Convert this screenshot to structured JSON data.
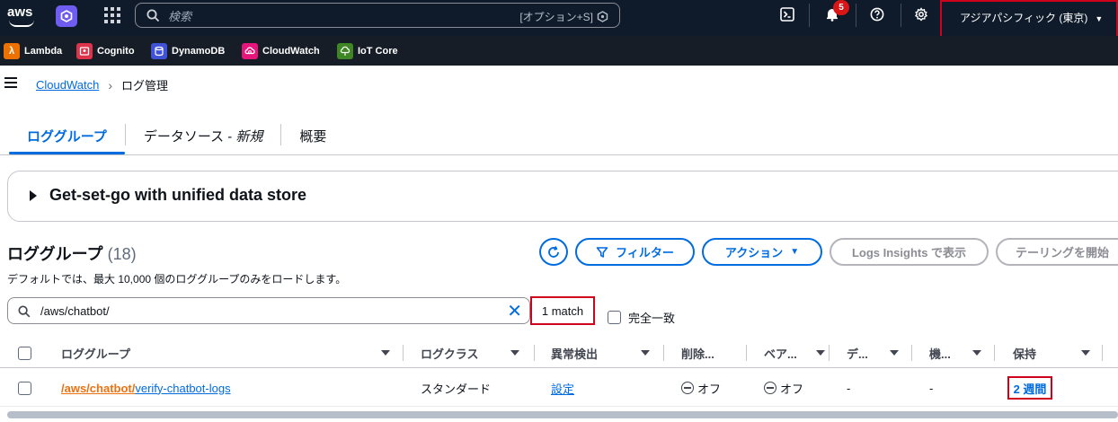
{
  "topnav": {
    "logo_text": "aws",
    "search_placeholder": "検索",
    "search_shortcut": "[オプション+S]",
    "notifications_count": "5",
    "region": "アジアパシフィック (東京)"
  },
  "favorites": [
    {
      "label": "Lambda",
      "color": "#ed7100",
      "icon": "lambda-icon"
    },
    {
      "label": "Cognito",
      "color": "#dd344c",
      "icon": "cognito-icon"
    },
    {
      "label": "DynamoDB",
      "color": "#4053d6",
      "icon": "dynamodb-icon"
    },
    {
      "label": "CloudWatch",
      "color": "#e7157b",
      "icon": "cloudwatch-icon"
    },
    {
      "label": "IoT Core",
      "color": "#3f8624",
      "icon": "iot-core-icon"
    }
  ],
  "breadcrumb": {
    "root": "CloudWatch",
    "current": "ログ管理"
  },
  "tabs": {
    "log_groups": "ロググループ",
    "data_sources_prefix": "データソース - ",
    "data_sources_new": "新規",
    "overview": "概要"
  },
  "expander": {
    "title": "Get-set-go with unified data store"
  },
  "section": {
    "title": "ロググループ",
    "count": "(18)",
    "description": "デフォルトでは、最大 10,000 個のロググループのみをロードします。"
  },
  "actions": {
    "filter": "フィルター",
    "actions": "アクション",
    "logs_insights": "Logs Insights で表示",
    "tailing": "テーリングを開始"
  },
  "filter": {
    "value": "/aws/chatbot/",
    "match": "1 match",
    "exact_label": "完全一致"
  },
  "table": {
    "headers": {
      "log_group": "ロググループ",
      "log_class": "ログクラス",
      "anomaly": "異常検出",
      "deletion": "削除...",
      "bare": "ベア...",
      "de": "デ...",
      "machine": "機...",
      "retention": "保持"
    },
    "rows": [
      {
        "log_group_highlight": "/aws/chatbot/",
        "log_group_rest": "verify-chatbot-logs",
        "log_class": "スタンダード",
        "anomaly": "設定",
        "deletion": "オフ",
        "bare": "オフ",
        "de": "-",
        "machine": "-",
        "retention": "2 週間"
      }
    ]
  },
  "colors": {
    "accent": "#006ce0",
    "nav_bg": "#0f1b2a",
    "highlight_box": "#d0021b",
    "match_text": "#ec7211"
  }
}
